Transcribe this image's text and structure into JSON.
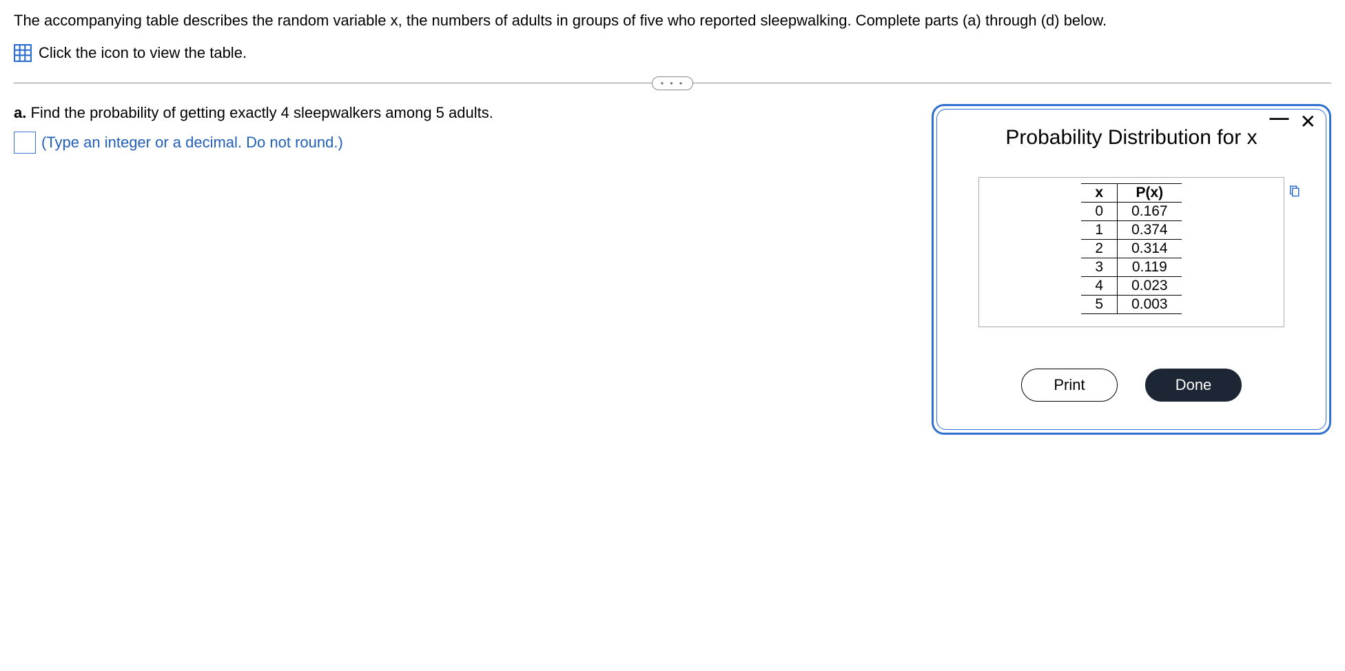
{
  "intro_text": "The accompanying table describes the random variable x, the numbers of adults in groups of five who reported sleepwalking. Complete parts (a) through (d) below.",
  "icon_link_text": "Click the icon to view the table.",
  "part_a": {
    "label": "a.",
    "question": " Find the probability of getting exactly 4 sleepwalkers among 5 adults.",
    "hint": "(Type an integer or a decimal. Do not round.)"
  },
  "modal": {
    "title": "Probability Distribution for x",
    "headers": {
      "col1": "x",
      "col2": "P(x)"
    },
    "rows": [
      {
        "x": "0",
        "p": "0.167"
      },
      {
        "x": "1",
        "p": "0.374"
      },
      {
        "x": "2",
        "p": "0.314"
      },
      {
        "x": "3",
        "p": "0.119"
      },
      {
        "x": "4",
        "p": "0.023"
      },
      {
        "x": "5",
        "p": "0.003"
      }
    ],
    "print_label": "Print",
    "done_label": "Done"
  },
  "collapse_dots": "• • •"
}
